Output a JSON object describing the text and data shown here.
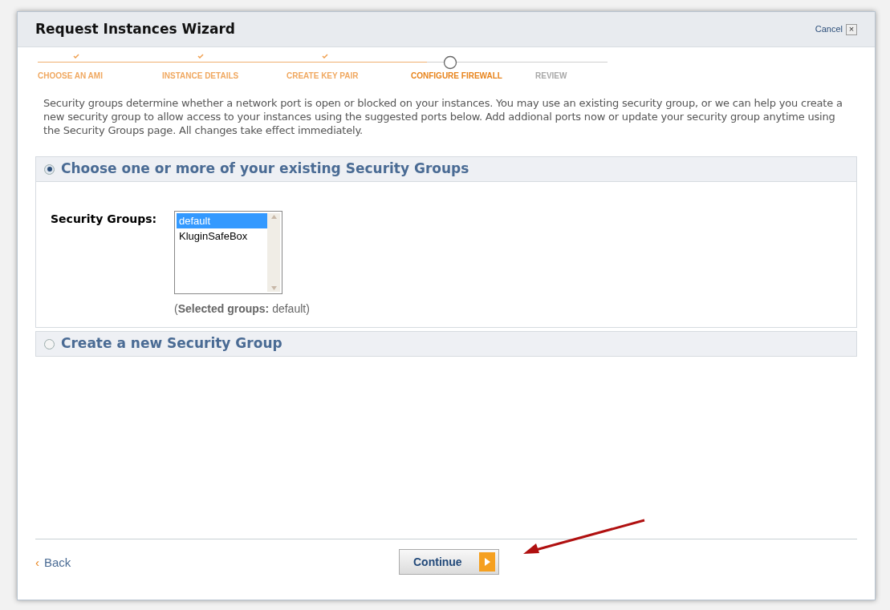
{
  "window": {
    "title": "Request Instances Wizard",
    "cancel": "Cancel",
    "close": "×"
  },
  "steps": [
    {
      "label": "CHOOSE AN AMI",
      "completed": true,
      "selected": false
    },
    {
      "label": "INSTANCE DETAILS",
      "completed": true,
      "selected": false
    },
    {
      "label": "CREATE KEY PAIR",
      "completed": true,
      "selected": false
    },
    {
      "label": "CONFIGURE FIREWALL",
      "completed": false,
      "selected": true
    },
    {
      "label": "REVIEW",
      "completed": false,
      "selected": false
    }
  ],
  "description": "Security groups determine whether a network port is open or blocked on your instances. You may use an existing security group, or we can help you create a new security group to allow access to your instances using the suggested ports below. Add addional ports now or update your security group anytime using the Security Groups page. All changes take effect immediately.",
  "sections": [
    {
      "title": "Choose one or more of your existing Security Groups",
      "selected": true,
      "expanded": true,
      "field_label": "Security Groups:",
      "options": [
        {
          "label": "default",
          "selected": true
        },
        {
          "label": "KluginSafeBox",
          "selected": false
        }
      ],
      "summary": "(**Selected groups:** default)"
    },
    {
      "title": "Create a new Security Group",
      "selected": false,
      "expanded": false
    }
  ],
  "footer": {
    "back": "Back",
    "back_icon": "‹",
    "continue": "Continue"
  }
}
